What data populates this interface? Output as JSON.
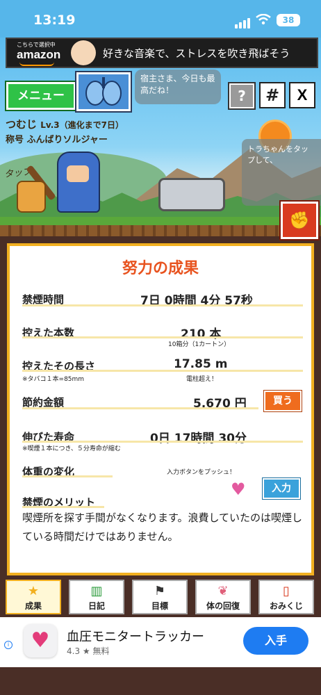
{
  "status_bar": {
    "time": "13:19",
    "battery": "38"
  },
  "top_ad": {
    "small_text": "こちらで選択中",
    "brand": "amazon",
    "text": "好きな音楽で、ストレスを吹き飛ばそう"
  },
  "header": {
    "menu_label": "メニュー",
    "speech": "宿主さま、今日も最高だね！",
    "help_label": "?",
    "hash_label": "#",
    "x_label": "X"
  },
  "character": {
    "name": "つむじ",
    "level": "Lv.3（進化まで7日）",
    "title": "称号 ふんばりソルジャー",
    "tap_hint": "タップ",
    "speech": "トラちゃんをタップして、"
  },
  "results": {
    "title": "努力の成果",
    "smoke_free_time": {
      "label": "禁煙時間",
      "value": "7日 0時間 4分 57秒"
    },
    "cigarettes_avoided": {
      "label": "控えた本数",
      "value": "210 本",
      "sub": "10箱分（1カートン）"
    },
    "length_avoided": {
      "label": "控えたその長さ",
      "value": "17.85 m",
      "note": "※タバコ１本=85mm",
      "sub": "電柱超え！"
    },
    "money_saved": {
      "label": "節約金額",
      "value": "5,670 円",
      "button": "買う"
    },
    "life_extended": {
      "label": "伸びた寿命",
      "value": "0日 17時間 30分",
      "note": "※喫煙１本につき、５分寿命が縮む"
    },
    "weight_change": {
      "label": "体重の変化",
      "hint": "入力ボタンをプッシュ！",
      "button": "入力"
    },
    "merit": {
      "label": "禁煙のメリット",
      "text": "喫煙所を探す手間がなくなります。浪費していたのは喫煙している時間だけではありません。"
    }
  },
  "tabs": [
    {
      "label": "成果",
      "icon": "star-icon",
      "active": true
    },
    {
      "label": "日記",
      "icon": "book-icon",
      "active": false
    },
    {
      "label": "目標",
      "icon": "flag-icon",
      "active": false
    },
    {
      "label": "体の回復",
      "icon": "lungs-icon",
      "active": false
    },
    {
      "label": "おみくじ",
      "icon": "omikuji-icon",
      "active": false
    }
  ],
  "bottom_ad": {
    "app_name": "血圧モニタートラッカー",
    "rating": "4.3 ★ 無料",
    "button": "入手"
  }
}
